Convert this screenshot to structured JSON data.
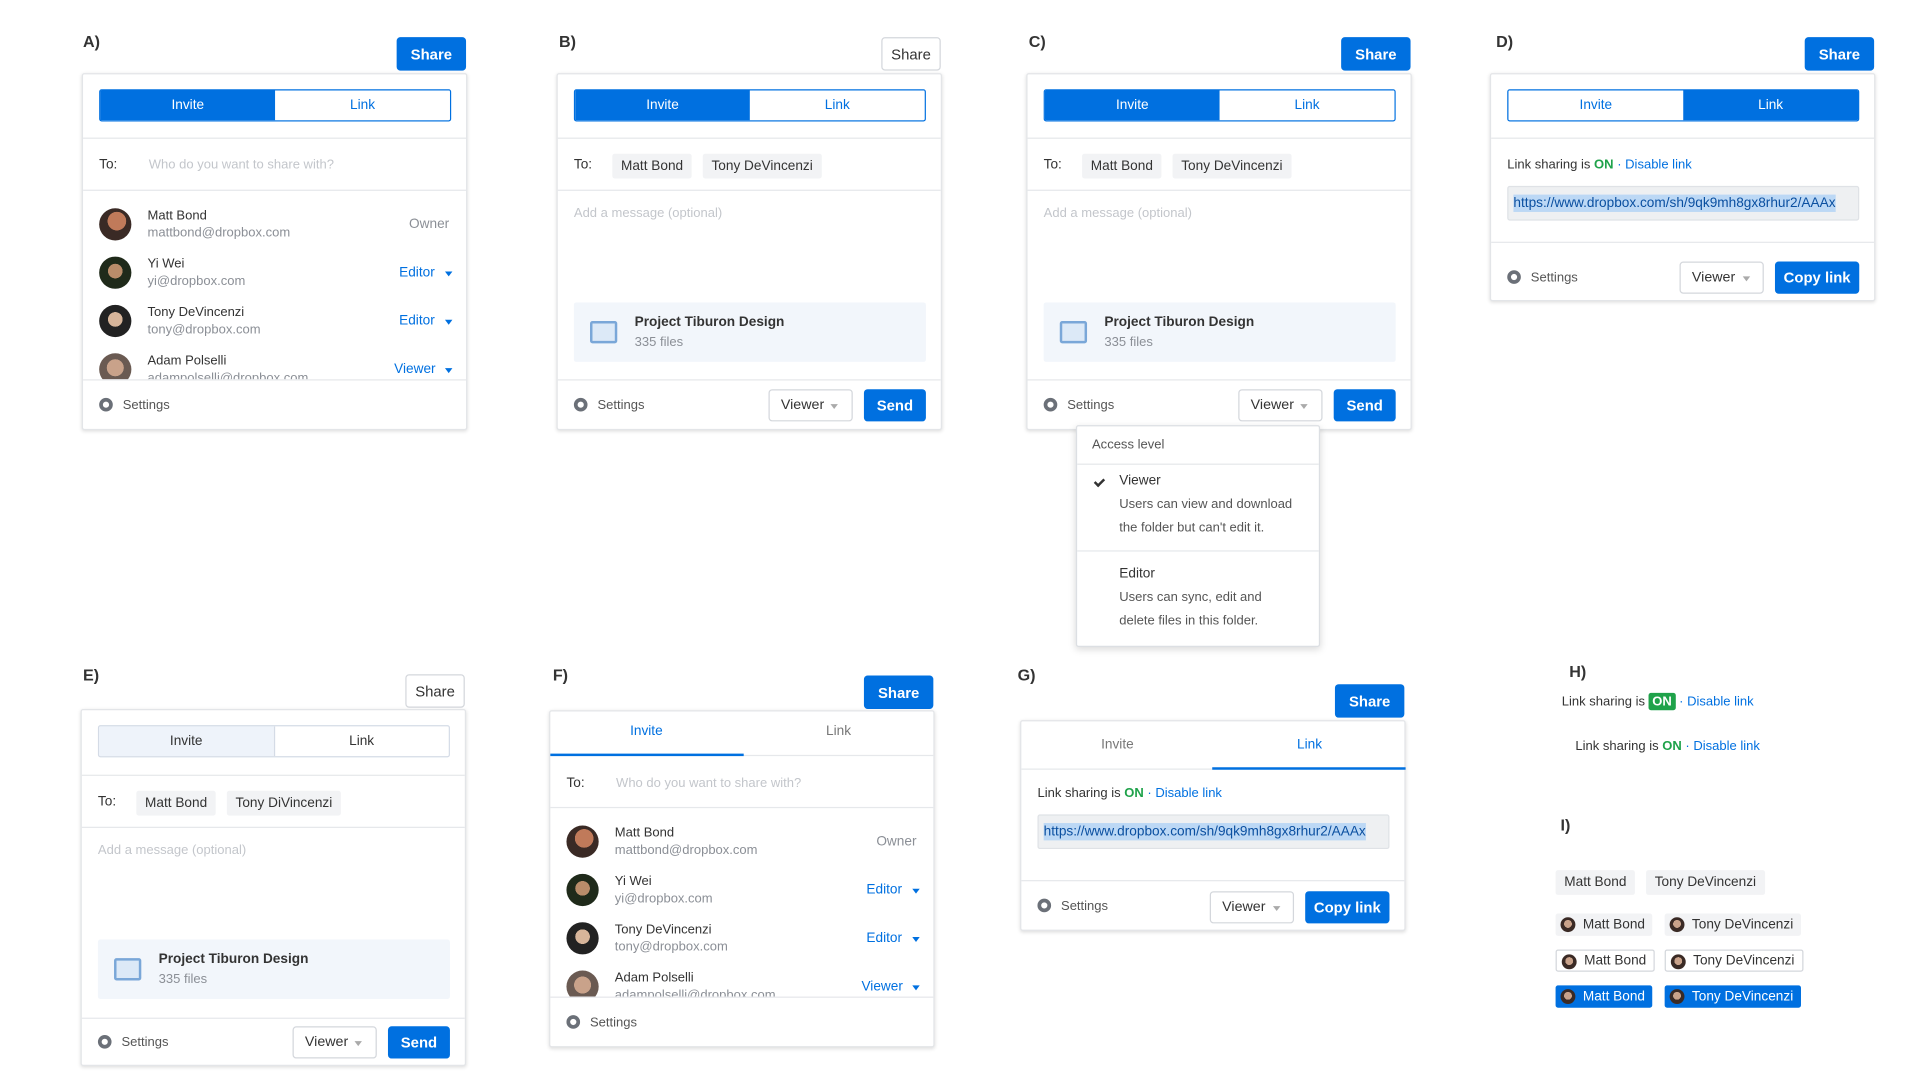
{
  "labels": {
    "a": "A)",
    "b": "B)",
    "c": "C)",
    "d": "D)",
    "e": "E)",
    "f": "F)",
    "g": "G)",
    "h": "H)",
    "i": "I)"
  },
  "share": "Share",
  "tabs": {
    "invite": "Invite",
    "link": "Link"
  },
  "to": "To:",
  "to_placeholder": "Who do you want to share with?",
  "message_placeholder": "Add a message (optional)",
  "people": [
    {
      "name": "Matt Bond",
      "email": "mattbond@dropbox.com",
      "role": "Owner"
    },
    {
      "name": "Yi Wei",
      "email": "yi@dropbox.com",
      "role": "Editor"
    },
    {
      "name": "Tony DeVincenzi",
      "email": "tony@dropbox.com",
      "role": "Editor"
    },
    {
      "name": "Adam Polselli",
      "email": "adampolselli@dropbox.com",
      "role": "Viewer"
    }
  ],
  "chips": [
    "Matt Bond",
    "Tony DeVincenzi"
  ],
  "chips_e": [
    "Matt Bond",
    "Tony DiVincenzi"
  ],
  "settings": "Settings",
  "folder": {
    "name": "Project Tiburon Design",
    "count": "335 files"
  },
  "viewer": "Viewer",
  "send": "Send",
  "copy_link": "Copy link",
  "link_sharing_is": "Link sharing is",
  "on": "ON",
  "dot": "·",
  "disable_link": "Disable link",
  "url": "https://www.dropbox.com/sh/9qk9mh8gx8rhur2/AAAx",
  "dropdown": {
    "title": "Access level",
    "viewer_title": "Viewer",
    "viewer_desc1": "Users can view and download",
    "viewer_desc2": "the folder but can't edit it.",
    "editor_title": "Editor",
    "editor_desc1": "Users can sync, edit and",
    "editor_desc2": "delete files in this folder."
  },
  "colors": {
    "accent": "#0070e0",
    "on_green": "#1fa24a"
  }
}
